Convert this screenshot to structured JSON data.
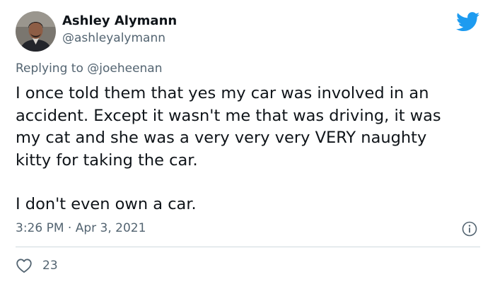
{
  "author": {
    "name": "Ashley Alymann",
    "handle": "@ashleyalymann"
  },
  "reply": {
    "prefix": "Replying to ",
    "mention": "@joeheenan"
  },
  "tweet": {
    "lines": [
      "I once told them that yes my car was involved in an",
      "accident. Except it wasn't me that was driving, it was",
      "my cat and she was a very very very VERY naughty",
      "kitty for taking the car."
    ],
    "second_paragraph": "I don't even own a car.",
    "timestamp": "3:26 PM · Apr 3, 2021"
  },
  "actions": {
    "like_count": "23"
  },
  "icons": {
    "brand": "twitter-bird-icon",
    "info": "info-icon",
    "like": "heart-icon"
  },
  "colors": {
    "brand": "#1d9bf0",
    "text": "#0f1419",
    "secondary": "#536471",
    "divider": "#cfd9de"
  }
}
